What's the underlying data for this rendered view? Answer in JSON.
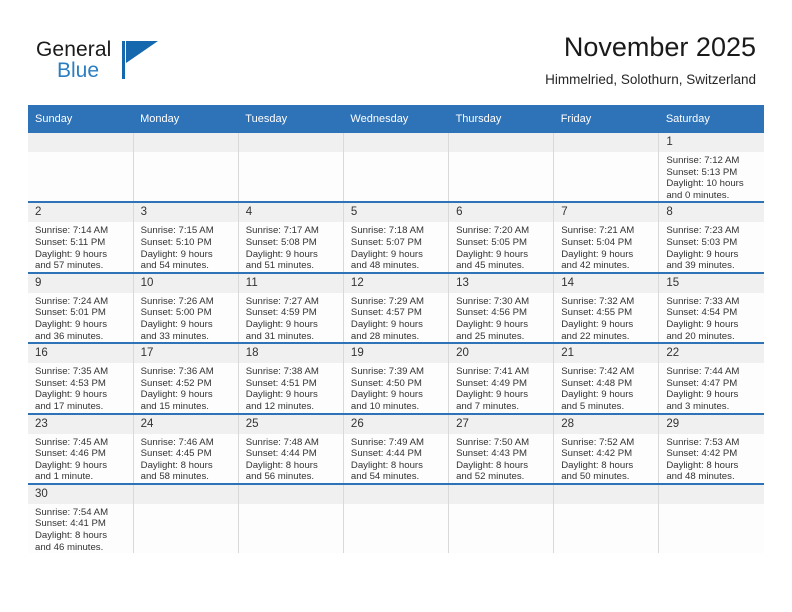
{
  "brand": {
    "name_top": "General",
    "name_bottom": "Blue",
    "accent_color": "#2b7ec1",
    "triangle_color": "#1668ae"
  },
  "header": {
    "title": "November 2025",
    "subtitle": "Himmelried, Solothurn, Switzerland",
    "header_bg_color": "#2e72b8",
    "row_divider_color": "#2e72b8",
    "daynum_bg_color": "#f0f0f0"
  },
  "weekday_headers": [
    "Sunday",
    "Monday",
    "Tuesday",
    "Wednesday",
    "Thursday",
    "Friday",
    "Saturday"
  ],
  "weeks": [
    {
      "days": [
        {
          "num": "",
          "sunrise": "",
          "sunset": "",
          "daylight_line1": "",
          "daylight_line2": "",
          "blank": true
        },
        {
          "num": "",
          "sunrise": "",
          "sunset": "",
          "daylight_line1": "",
          "daylight_line2": "",
          "blank": true
        },
        {
          "num": "",
          "sunrise": "",
          "sunset": "",
          "daylight_line1": "",
          "daylight_line2": "",
          "blank": true
        },
        {
          "num": "",
          "sunrise": "",
          "sunset": "",
          "daylight_line1": "",
          "daylight_line2": "",
          "blank": true
        },
        {
          "num": "",
          "sunrise": "",
          "sunset": "",
          "daylight_line1": "",
          "daylight_line2": "",
          "blank": true
        },
        {
          "num": "",
          "sunrise": "",
          "sunset": "",
          "daylight_line1": "",
          "daylight_line2": "",
          "blank": true
        },
        {
          "num": "1",
          "sunrise": "Sunrise: 7:12 AM",
          "sunset": "Sunset: 5:13 PM",
          "daylight_line1": "Daylight: 10 hours",
          "daylight_line2": "and 0 minutes.",
          "blank": false
        }
      ]
    },
    {
      "days": [
        {
          "num": "2",
          "sunrise": "Sunrise: 7:14 AM",
          "sunset": "Sunset: 5:11 PM",
          "daylight_line1": "Daylight: 9 hours",
          "daylight_line2": "and 57 minutes.",
          "blank": false
        },
        {
          "num": "3",
          "sunrise": "Sunrise: 7:15 AM",
          "sunset": "Sunset: 5:10 PM",
          "daylight_line1": "Daylight: 9 hours",
          "daylight_line2": "and 54 minutes.",
          "blank": false
        },
        {
          "num": "4",
          "sunrise": "Sunrise: 7:17 AM",
          "sunset": "Sunset: 5:08 PM",
          "daylight_line1": "Daylight: 9 hours",
          "daylight_line2": "and 51 minutes.",
          "blank": false
        },
        {
          "num": "5",
          "sunrise": "Sunrise: 7:18 AM",
          "sunset": "Sunset: 5:07 PM",
          "daylight_line1": "Daylight: 9 hours",
          "daylight_line2": "and 48 minutes.",
          "blank": false
        },
        {
          "num": "6",
          "sunrise": "Sunrise: 7:20 AM",
          "sunset": "Sunset: 5:05 PM",
          "daylight_line1": "Daylight: 9 hours",
          "daylight_line2": "and 45 minutes.",
          "blank": false
        },
        {
          "num": "7",
          "sunrise": "Sunrise: 7:21 AM",
          "sunset": "Sunset: 5:04 PM",
          "daylight_line1": "Daylight: 9 hours",
          "daylight_line2": "and 42 minutes.",
          "blank": false
        },
        {
          "num": "8",
          "sunrise": "Sunrise: 7:23 AM",
          "sunset": "Sunset: 5:03 PM",
          "daylight_line1": "Daylight: 9 hours",
          "daylight_line2": "and 39 minutes.",
          "blank": false
        }
      ]
    },
    {
      "days": [
        {
          "num": "9",
          "sunrise": "Sunrise: 7:24 AM",
          "sunset": "Sunset: 5:01 PM",
          "daylight_line1": "Daylight: 9 hours",
          "daylight_line2": "and 36 minutes.",
          "blank": false
        },
        {
          "num": "10",
          "sunrise": "Sunrise: 7:26 AM",
          "sunset": "Sunset: 5:00 PM",
          "daylight_line1": "Daylight: 9 hours",
          "daylight_line2": "and 33 minutes.",
          "blank": false
        },
        {
          "num": "11",
          "sunrise": "Sunrise: 7:27 AM",
          "sunset": "Sunset: 4:59 PM",
          "daylight_line1": "Daylight: 9 hours",
          "daylight_line2": "and 31 minutes.",
          "blank": false
        },
        {
          "num": "12",
          "sunrise": "Sunrise: 7:29 AM",
          "sunset": "Sunset: 4:57 PM",
          "daylight_line1": "Daylight: 9 hours",
          "daylight_line2": "and 28 minutes.",
          "blank": false
        },
        {
          "num": "13",
          "sunrise": "Sunrise: 7:30 AM",
          "sunset": "Sunset: 4:56 PM",
          "daylight_line1": "Daylight: 9 hours",
          "daylight_line2": "and 25 minutes.",
          "blank": false
        },
        {
          "num": "14",
          "sunrise": "Sunrise: 7:32 AM",
          "sunset": "Sunset: 4:55 PM",
          "daylight_line1": "Daylight: 9 hours",
          "daylight_line2": "and 22 minutes.",
          "blank": false
        },
        {
          "num": "15",
          "sunrise": "Sunrise: 7:33 AM",
          "sunset": "Sunset: 4:54 PM",
          "daylight_line1": "Daylight: 9 hours",
          "daylight_line2": "and 20 minutes.",
          "blank": false
        }
      ]
    },
    {
      "days": [
        {
          "num": "16",
          "sunrise": "Sunrise: 7:35 AM",
          "sunset": "Sunset: 4:53 PM",
          "daylight_line1": "Daylight: 9 hours",
          "daylight_line2": "and 17 minutes.",
          "blank": false
        },
        {
          "num": "17",
          "sunrise": "Sunrise: 7:36 AM",
          "sunset": "Sunset: 4:52 PM",
          "daylight_line1": "Daylight: 9 hours",
          "daylight_line2": "and 15 minutes.",
          "blank": false
        },
        {
          "num": "18",
          "sunrise": "Sunrise: 7:38 AM",
          "sunset": "Sunset: 4:51 PM",
          "daylight_line1": "Daylight: 9 hours",
          "daylight_line2": "and 12 minutes.",
          "blank": false
        },
        {
          "num": "19",
          "sunrise": "Sunrise: 7:39 AM",
          "sunset": "Sunset: 4:50 PM",
          "daylight_line1": "Daylight: 9 hours",
          "daylight_line2": "and 10 minutes.",
          "blank": false
        },
        {
          "num": "20",
          "sunrise": "Sunrise: 7:41 AM",
          "sunset": "Sunset: 4:49 PM",
          "daylight_line1": "Daylight: 9 hours",
          "daylight_line2": "and 7 minutes.",
          "blank": false
        },
        {
          "num": "21",
          "sunrise": "Sunrise: 7:42 AM",
          "sunset": "Sunset: 4:48 PM",
          "daylight_line1": "Daylight: 9 hours",
          "daylight_line2": "and 5 minutes.",
          "blank": false
        },
        {
          "num": "22",
          "sunrise": "Sunrise: 7:44 AM",
          "sunset": "Sunset: 4:47 PM",
          "daylight_line1": "Daylight: 9 hours",
          "daylight_line2": "and 3 minutes.",
          "blank": false
        }
      ]
    },
    {
      "days": [
        {
          "num": "23",
          "sunrise": "Sunrise: 7:45 AM",
          "sunset": "Sunset: 4:46 PM",
          "daylight_line1": "Daylight: 9 hours",
          "daylight_line2": "and 1 minute.",
          "blank": false
        },
        {
          "num": "24",
          "sunrise": "Sunrise: 7:46 AM",
          "sunset": "Sunset: 4:45 PM",
          "daylight_line1": "Daylight: 8 hours",
          "daylight_line2": "and 58 minutes.",
          "blank": false
        },
        {
          "num": "25",
          "sunrise": "Sunrise: 7:48 AM",
          "sunset": "Sunset: 4:44 PM",
          "daylight_line1": "Daylight: 8 hours",
          "daylight_line2": "and 56 minutes.",
          "blank": false
        },
        {
          "num": "26",
          "sunrise": "Sunrise: 7:49 AM",
          "sunset": "Sunset: 4:44 PM",
          "daylight_line1": "Daylight: 8 hours",
          "daylight_line2": "and 54 minutes.",
          "blank": false
        },
        {
          "num": "27",
          "sunrise": "Sunrise: 7:50 AM",
          "sunset": "Sunset: 4:43 PM",
          "daylight_line1": "Daylight: 8 hours",
          "daylight_line2": "and 52 minutes.",
          "blank": false
        },
        {
          "num": "28",
          "sunrise": "Sunrise: 7:52 AM",
          "sunset": "Sunset: 4:42 PM",
          "daylight_line1": "Daylight: 8 hours",
          "daylight_line2": "and 50 minutes.",
          "blank": false
        },
        {
          "num": "29",
          "sunrise": "Sunrise: 7:53 AM",
          "sunset": "Sunset: 4:42 PM",
          "daylight_line1": "Daylight: 8 hours",
          "daylight_line2": "and 48 minutes.",
          "blank": false
        }
      ]
    },
    {
      "days": [
        {
          "num": "30",
          "sunrise": "Sunrise: 7:54 AM",
          "sunset": "Sunset: 4:41 PM",
          "daylight_line1": "Daylight: 8 hours",
          "daylight_line2": "and 46 minutes.",
          "blank": false
        },
        {
          "num": "",
          "sunrise": "",
          "sunset": "",
          "daylight_line1": "",
          "daylight_line2": "",
          "blank": true
        },
        {
          "num": "",
          "sunrise": "",
          "sunset": "",
          "daylight_line1": "",
          "daylight_line2": "",
          "blank": true
        },
        {
          "num": "",
          "sunrise": "",
          "sunset": "",
          "daylight_line1": "",
          "daylight_line2": "",
          "blank": true
        },
        {
          "num": "",
          "sunrise": "",
          "sunset": "",
          "daylight_line1": "",
          "daylight_line2": "",
          "blank": true
        },
        {
          "num": "",
          "sunrise": "",
          "sunset": "",
          "daylight_line1": "",
          "daylight_line2": "",
          "blank": true
        },
        {
          "num": "",
          "sunrise": "",
          "sunset": "",
          "daylight_line1": "",
          "daylight_line2": "",
          "blank": true
        }
      ]
    }
  ]
}
